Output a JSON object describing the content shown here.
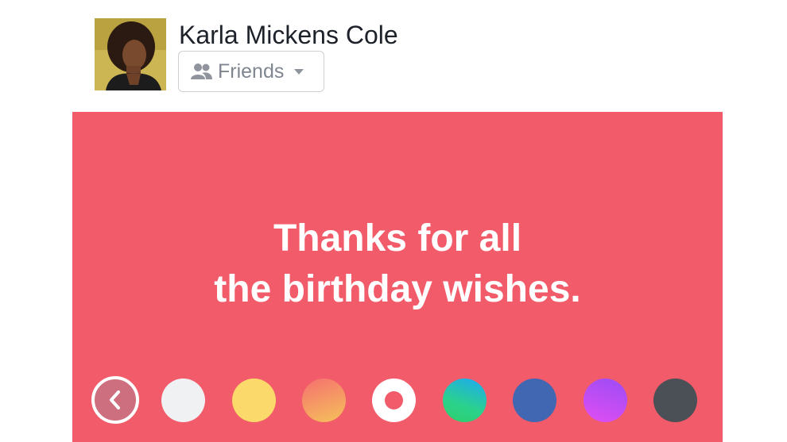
{
  "user": {
    "name": "Karla Mickens Cole"
  },
  "audience": {
    "label": "Friends",
    "icon": "friends-icon",
    "caret_icon": "caret-down-icon"
  },
  "post": {
    "background_color": "#f25b69",
    "text_lines": [
      "Thanks for all",
      "the birthday wishes."
    ]
  },
  "palette": {
    "back_icon": "chevron-left-icon",
    "swatches": [
      {
        "name": "white",
        "color": "#eff1f3"
      },
      {
        "name": "yellow",
        "color": "#fbd96b"
      },
      {
        "name": "orange-gradient",
        "color": "#f4a35f"
      },
      {
        "name": "red-selected",
        "color": "#f25b69",
        "selected": true
      },
      {
        "name": "green-blue-gradient",
        "color": "#2fc6a6"
      },
      {
        "name": "blue",
        "color": "#4267b2"
      },
      {
        "name": "purple-gradient",
        "color": "#b84ff5"
      },
      {
        "name": "dark-gray",
        "color": "#4b4f56"
      }
    ]
  }
}
